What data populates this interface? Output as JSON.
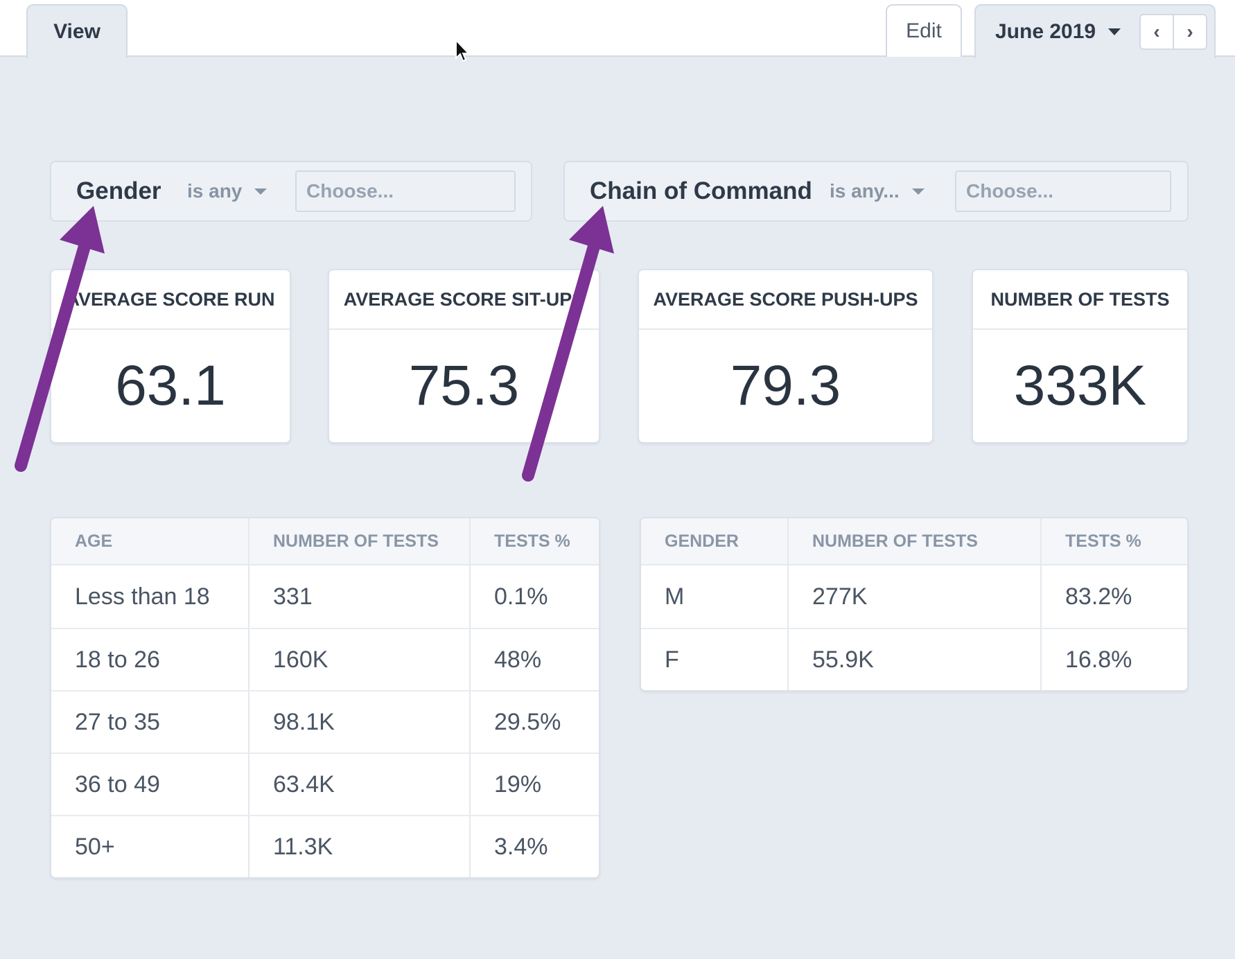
{
  "tabs": {
    "view_label": "View",
    "edit_label": "Edit",
    "date_label": "June 2019"
  },
  "nav": {
    "prev_icon": "chevron-left-icon",
    "next_icon": "chevron-right-icon",
    "prev_glyph": "‹",
    "next_glyph": "›"
  },
  "filters": [
    {
      "label": "Gender",
      "operator": "is any",
      "placeholder": "Choose..."
    },
    {
      "label": "Chain of Command",
      "operator": "is any...",
      "placeholder": "Choose..."
    }
  ],
  "stats": [
    {
      "title": "AVERAGE SCORE RUN",
      "value": "63.1"
    },
    {
      "title": "AVERAGE SCORE SIT-UPS",
      "value": "75.3"
    },
    {
      "title": "AVERAGE SCORE PUSH-UPS",
      "value": "79.3"
    },
    {
      "title": "NUMBER OF TESTS",
      "value": "333K"
    }
  ],
  "age_table": {
    "headers": [
      "AGE",
      "NUMBER OF TESTS",
      "TESTS %"
    ],
    "rows": [
      [
        "Less than 18",
        "331",
        "0.1%"
      ],
      [
        "18 to 26",
        "160K",
        "48%"
      ],
      [
        "27 to 35",
        "98.1K",
        "29.5%"
      ],
      [
        "36 to 49",
        "63.4K",
        "19%"
      ],
      [
        "50+",
        "11.3K",
        "3.4%"
      ]
    ]
  },
  "gender_table": {
    "headers": [
      "GENDER",
      "NUMBER OF TESTS",
      "TESTS %"
    ],
    "rows": [
      [
        "M",
        "277K",
        "83.2%"
      ],
      [
        "F",
        "55.9K",
        "16.8%"
      ]
    ]
  },
  "colors": {
    "background": "#e6ebf2",
    "annotation_arrow": "#7b3294",
    "text_dark": "#2f3a48",
    "text_muted": "#8a96a6"
  }
}
